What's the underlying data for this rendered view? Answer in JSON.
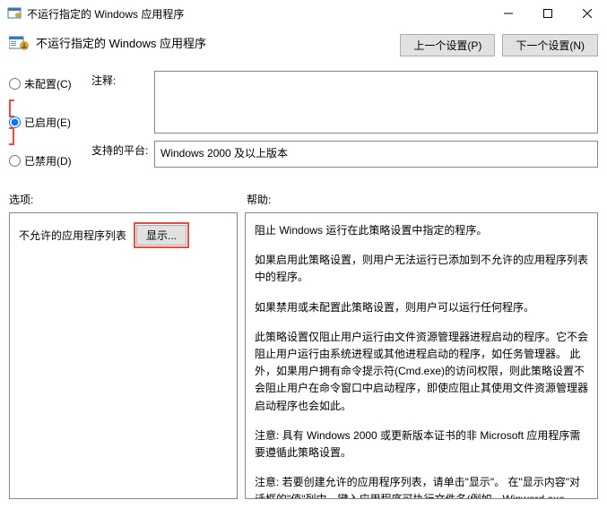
{
  "window": {
    "title": "不运行指定的 Windows 应用程序"
  },
  "header": {
    "title": "不运行指定的 Windows 应用程序",
    "prev_btn": "上一个设置(P)",
    "next_btn": "下一个设置(N)"
  },
  "radios": {
    "not_configured": "未配置(C)",
    "enabled": "已启用(E)",
    "disabled": "已禁用(D)",
    "selected": "enabled"
  },
  "fields": {
    "comment_label": "注释:",
    "comment_value": "",
    "platform_label": "支持的平台:",
    "platform_value": "Windows 2000 及以上版本"
  },
  "sections": {
    "options_label": "选项:",
    "help_label": "帮助:"
  },
  "options": {
    "list_label": "不允许的应用程序列表",
    "show_btn": "显示..."
  },
  "help": {
    "p1": "阻止 Windows 运行在此策略设置中指定的程序。",
    "p2": "如果启用此策略设置，则用户无法运行已添加到不允许的应用程序列表中的程序。",
    "p3": "如果禁用或未配置此策略设置，则用户可以运行任何程序。",
    "p4": "此策略设置仅阻止用户运行由文件资源管理器进程启动的程序。它不会阻止用户运行由系统进程或其他进程启动的程序，如任务管理器。 此外，如果用户拥有命令提示符(Cmd.exe)的访问权限，则此策略设置不会阻止用户在命令窗口中启动程序，即使应阻止其使用文件资源管理器启动程序也会如此。",
    "p5": "注意: 具有 Windows 2000 或更新版本证书的非 Microsoft 应用程序需要遵循此策略设置。",
    "p6": "注意: 若要创建允许的应用程序列表，请单击\"显示\"。 在\"显示内容\"对话框的\"值\"列中，键入应用程序可执行文件名(例如，Winword.exe、Poledit.exe 和 Powerpnt.exe)。"
  }
}
